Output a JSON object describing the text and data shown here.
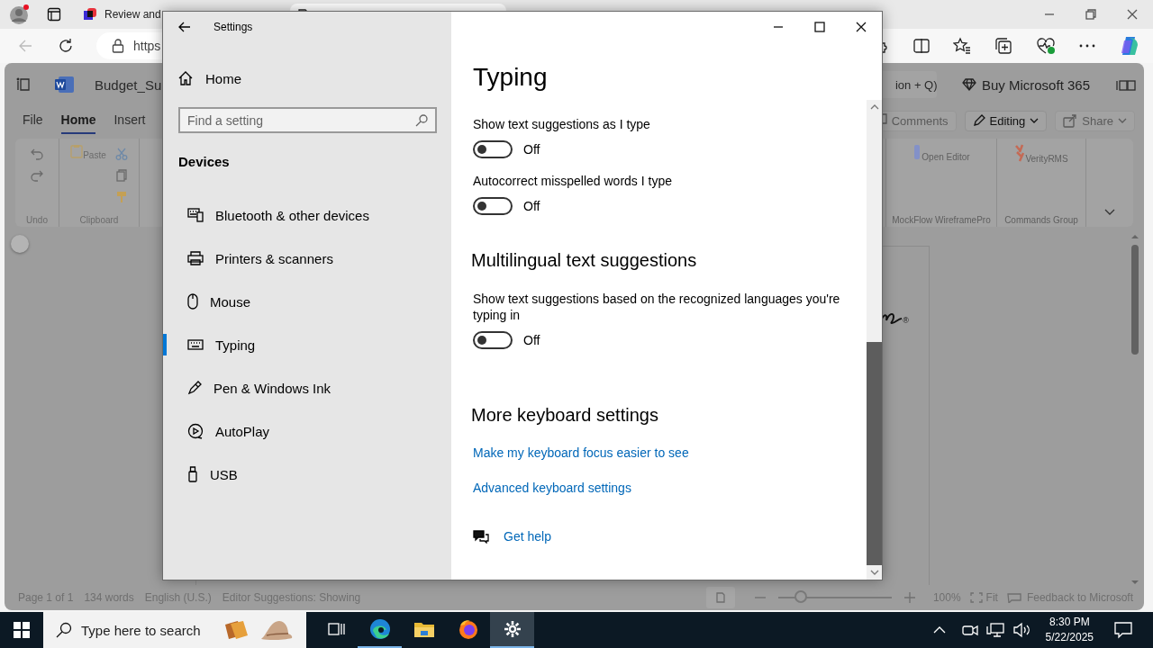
{
  "browser": {
    "tabs": [
      {
        "label": "Review and",
        "selected": false
      },
      {
        "selected": true
      }
    ],
    "address": "https"
  },
  "word": {
    "doc_title": "Budget_Su",
    "search_tail": "ion + Q)",
    "buy_label": "Buy Microsoft 365",
    "tabs": [
      {
        "label": "File",
        "selected": false
      },
      {
        "label": "Home",
        "selected": true
      },
      {
        "label": "Insert",
        "selected": false
      }
    ],
    "header_buttons": [
      {
        "label": "Comments",
        "disabled": true
      },
      {
        "label": "Editing",
        "disabled": false
      },
      {
        "label": "Share",
        "disabled": true
      }
    ],
    "ribbon_left_groups": [
      {
        "label": "Undo"
      },
      {
        "label": "Clipboard",
        "button": "Paste"
      }
    ],
    "ribbon_right_groups": [
      {
        "label": "MockFlow WireframePro",
        "button": "Open Editor"
      },
      {
        "label": "Commands Group",
        "button": "VerityRMS"
      }
    ],
    "doc_mark": "®",
    "status_left": [
      "Page 1 of 1",
      "134 words",
      "English (U.S.)",
      "Editor Suggestions: Showing"
    ],
    "zoom_slider": {
      "level": 0.2
    },
    "zoom": "100%",
    "fit": "Fit",
    "feedback": "Feedback to Microsoft"
  },
  "settings": {
    "title": "Settings",
    "home": "Home",
    "search": {
      "placeholder": "Find a setting"
    },
    "section": "Devices",
    "nav": [
      {
        "label": "Bluetooth & other devices",
        "selected": false
      },
      {
        "label": "Printers & scanners",
        "selected": false
      },
      {
        "label": "Mouse",
        "selected": false
      },
      {
        "label": "Typing",
        "selected": true
      },
      {
        "label": "Pen & Windows Ink",
        "selected": false
      },
      {
        "label": "AutoPlay",
        "selected": false
      },
      {
        "label": "USB",
        "selected": false
      }
    ],
    "page_title": "Typing",
    "sections": [
      {
        "items": [
          {
            "kind": "toggle",
            "label": "Show text suggestions as I type",
            "on": false,
            "state_text": "Off"
          },
          {
            "kind": "toggle",
            "label": "Autocorrect misspelled words I type",
            "on": false,
            "state_text": "Off"
          }
        ]
      },
      {
        "heading": "Multilingual text suggestions",
        "items": [
          {
            "kind": "toggle",
            "label": "Show text suggestions based on the recognized languages you're typing in",
            "on": false,
            "state_text": "Off"
          }
        ]
      },
      {
        "heading": "More keyboard settings",
        "items": [
          {
            "kind": "link",
            "label": "Make my keyboard focus easier to see"
          },
          {
            "kind": "link",
            "label": "Advanced keyboard settings"
          }
        ]
      }
    ],
    "help": "Get help"
  },
  "taskbar": {
    "search": {
      "placeholder": "Type here to search"
    },
    "apps": [
      {
        "selected": false,
        "running": false
      },
      {
        "selected": false,
        "running": true
      },
      {
        "selected": false,
        "running": false
      },
      {
        "selected": false,
        "running": false
      },
      {
        "selected": true,
        "running": true
      }
    ],
    "time": "8:30 PM",
    "date": "5/22/2025"
  }
}
